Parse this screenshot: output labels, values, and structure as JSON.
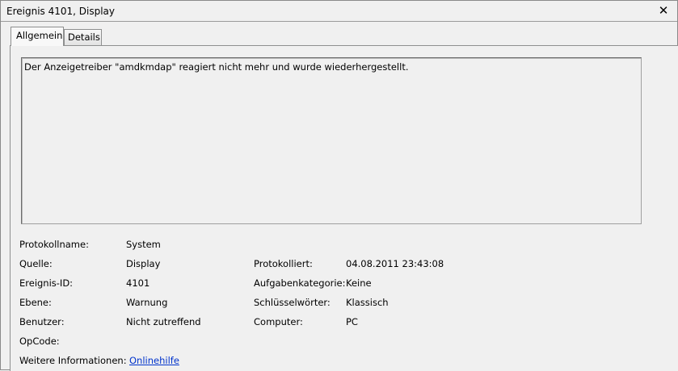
{
  "window": {
    "title": "Ereignis 4101, Display",
    "close_glyph": "✕"
  },
  "tabs": [
    {
      "label": "Allgemein",
      "active": true
    },
    {
      "label": "Details",
      "active": false
    }
  ],
  "message": "Der Anzeigetreiber \"amdkmdap\" reagiert nicht mehr und wurde wiederhergestellt.",
  "fields": {
    "protokollname": {
      "label": "Protokollname:",
      "value": "System"
    },
    "quelle": {
      "label": "Quelle:",
      "value": "Display"
    },
    "protokolliert": {
      "label": "Protokolliert:",
      "value": "04.08.2011 23:43:08"
    },
    "ereignis_id": {
      "label": "Ereignis-ID:",
      "value": "4101"
    },
    "aufgabenkategorie": {
      "label": "Aufgabenkategorie:",
      "value": "Keine"
    },
    "ebene": {
      "label": "Ebene:",
      "value": "Warnung"
    },
    "schluesselwoerter": {
      "label": "Schlüsselwörter:",
      "value": "Klassisch"
    },
    "benutzer": {
      "label": "Benutzer:",
      "value": "Nicht zutreffend"
    },
    "computer": {
      "label": "Computer:",
      "value": "PC"
    },
    "opcode": {
      "label": "OpCode:",
      "value": ""
    },
    "weitere": {
      "label": "Weitere Informationen:",
      "link": "Onlinehilfe"
    }
  },
  "colors": {
    "link": "#0033cc",
    "background": "#f0f0f0"
  }
}
